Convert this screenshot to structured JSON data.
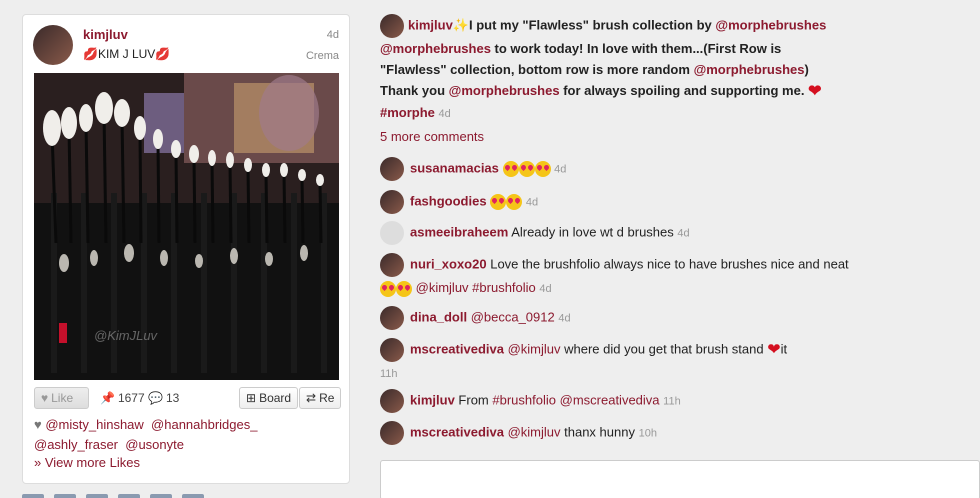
{
  "pin": {
    "username": "kimjluv",
    "display_name": "KIM J LUV",
    "time": "4d",
    "source": "Crema",
    "watermark": "@KimJLuv",
    "like_label": "Like",
    "repin_count": "1677",
    "comment_count": "13",
    "board_label": "Board",
    "repin_label": "Re",
    "likers": [
      "@misty_hinshaw",
      "@hannahbridges_",
      "@ashly_fraser",
      "@usonyte"
    ],
    "view_more_likes": "» View more Likes"
  },
  "caption": {
    "user": "kimjluv",
    "text_1": "I put my \"Flawless\" brush collection by",
    "mention_1": "@morphebrushes",
    "mention_2": "@morphebrushes",
    "text_2": "to work today! In love with them...(First Row is \"Flawless\" collection, bottom row is more random",
    "mention_3": "@morphebrushes",
    "text_3": ") Thank you",
    "mention_4": "@morphebrushes",
    "text_4": "for always spoiling and supporting me.",
    "hashtag": "#morphe",
    "time": "4d"
  },
  "more_comments": "5 more comments",
  "comments": [
    {
      "user": "susanamacias",
      "text": "",
      "time": "4d"
    },
    {
      "user": "fashgoodies",
      "text": "",
      "time": "4d"
    },
    {
      "user": "asmeeibraheem",
      "text": "Already in love wt d brushes",
      "time": "4d"
    },
    {
      "user": "nuri_xoxo20",
      "text": "Love the brushfolio always nice to have brushes nice and neat",
      "mention": "@kimjluv",
      "tag": "#brushfolio",
      "time": "4d"
    },
    {
      "user": "dina_doll",
      "mention": "@becca_0912",
      "time": "4d"
    },
    {
      "user": "mscreativediva",
      "mention": "@kimjluv",
      "text": "where did you get that brush stand",
      "text_end": "it",
      "time": "11h"
    },
    {
      "user": "kimjluv",
      "text": "From",
      "tag": "#brushfolio",
      "mention": "@mscreativediva",
      "time": "11h"
    },
    {
      "user": "mscreativediva",
      "mention": "@kimjluv",
      "text": "thanx hunny",
      "time": "10h"
    }
  ],
  "colors": {
    "link": "#8c1a2f",
    "background": "#eeeeee"
  }
}
